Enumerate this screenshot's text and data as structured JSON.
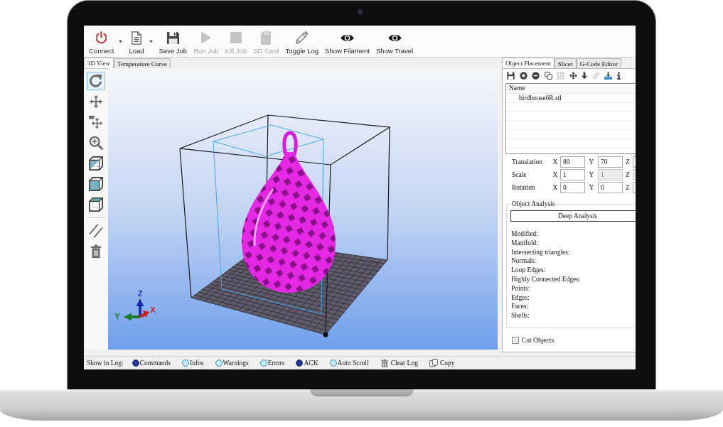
{
  "toolbar": [
    {
      "label": "Connect",
      "dropdown": true,
      "disabled": false
    },
    {
      "label": "Load",
      "dropdown": true,
      "disabled": false
    },
    {
      "label": "Save Job",
      "dropdown": false,
      "disabled": false
    },
    {
      "label": "Run Job",
      "dropdown": false,
      "disabled": true
    },
    {
      "label": "Kill Job",
      "dropdown": false,
      "disabled": true
    },
    {
      "label": "SD Card",
      "dropdown": false,
      "disabled": true
    },
    {
      "label": "Toggle Log",
      "dropdown": false,
      "disabled": false
    },
    {
      "label": "Show Filament",
      "dropdown": false,
      "disabled": false
    },
    {
      "label": "Show Travel",
      "dropdown": false,
      "disabled": false
    }
  ],
  "view_tabs": [
    {
      "label": "3D View",
      "selected": true
    },
    {
      "label": "Temperature Curve",
      "selected": false
    }
  ],
  "view_tools": [
    {
      "selected": true
    },
    {
      "selected": false
    },
    {
      "selected": false
    },
    {
      "selected": false
    },
    {
      "selected": false
    },
    {
      "selected": false
    },
    {
      "selected": false
    },
    {
      "selected": false
    },
    {
      "selected": false
    }
  ],
  "scene": {
    "axes": [
      {
        "label": "Z",
        "color": "#1b2fae"
      },
      {
        "label": "Y",
        "color": "#1d7a2b"
      },
      {
        "label": "X",
        "color": "#c81f1f"
      }
    ]
  },
  "panel_tabs": [
    {
      "label": "Object Placement",
      "selected": true
    },
    {
      "label": "Slicer",
      "selected": false
    },
    {
      "label": "G-Code Editor",
      "selected": false
    }
  ],
  "object_tools": [
    {
      "disabled": false
    },
    {
      "disabled": false
    },
    {
      "disabled": false
    },
    {
      "disabled": false
    },
    {
      "disabled": true
    },
    {
      "disabled": false
    },
    {
      "disabled": false
    },
    {
      "disabled": true
    },
    {
      "disabled": false
    },
    {
      "disabled": false
    }
  ],
  "object_list": {
    "columns": [
      "Name"
    ],
    "rows": [
      "birdhouse6R.stl"
    ]
  },
  "transform": [
    {
      "label": "Translation",
      "fields": [
        {
          "axis": "X",
          "value": "80",
          "disabled": false
        },
        {
          "axis": "Y",
          "value": "70",
          "disabled": false
        },
        {
          "axis": "Z",
          "disabled": false
        }
      ]
    },
    {
      "label": "Scale",
      "fields": [
        {
          "axis": "X",
          "value": "1",
          "disabled": false
        },
        {
          "axis": "Y",
          "value": "1",
          "disabled": true
        },
        {
          "axis": "Z",
          "disabled": true
        }
      ]
    },
    {
      "label": "Rotation",
      "fields": [
        {
          "axis": "X",
          "value": "0",
          "disabled": false
        },
        {
          "axis": "Y",
          "value": "0",
          "disabled": false
        },
        {
          "axis": "Z",
          "disabled": false
        }
      ]
    }
  ],
  "analysis": {
    "title": "Object Analysis",
    "button": "Deep Analysis",
    "properties": [
      "Modified:",
      "Manifold:",
      "Intersecting triangles:",
      "Normals:",
      "Loop Edges:",
      "Highly Connected Edges:",
      "Points:",
      "Edges:",
      "Faces:",
      "Shells:"
    ]
  },
  "cut_objects": {
    "label": "Cut Objects",
    "checked": false
  },
  "log_bar": {
    "label": "Show in Log:",
    "toggles": [
      {
        "label": "Commands",
        "on": true
      },
      {
        "label": "Infos",
        "on": false
      },
      {
        "label": "Warnings",
        "on": false
      },
      {
        "label": "Errors",
        "on": false
      },
      {
        "label": "ACK",
        "on": true
      },
      {
        "label": "Auto Scroll",
        "on": false
      }
    ],
    "actions": [
      "Clear Log",
      "Copy"
    ]
  }
}
